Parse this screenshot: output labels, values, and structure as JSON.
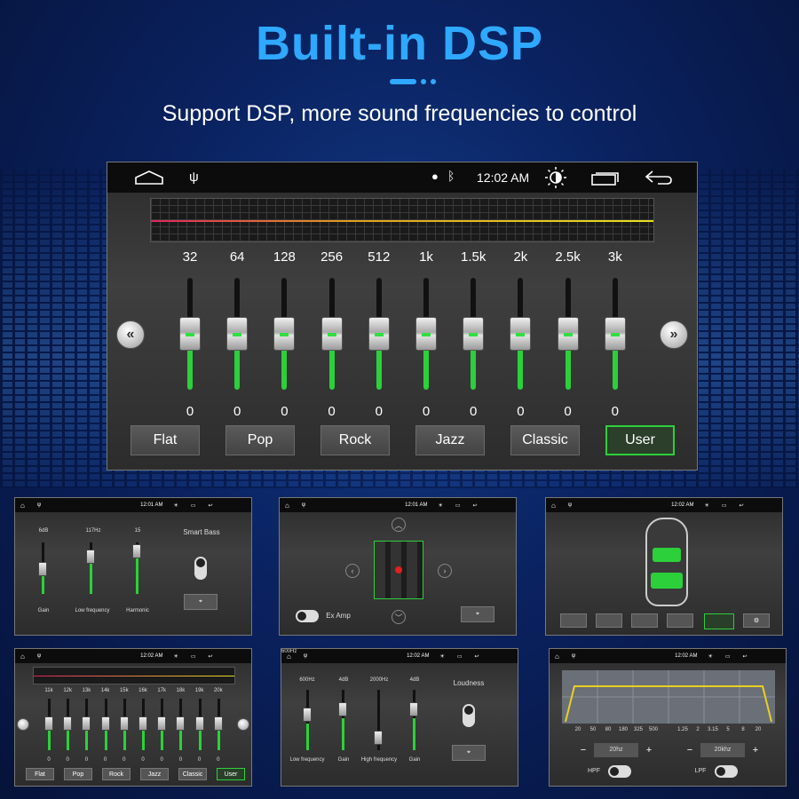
{
  "header": {
    "title": "Built-in DSP",
    "subtitle": "Support DSP, more sound frequencies to control"
  },
  "main_screen": {
    "status": {
      "time": "12:02 AM"
    },
    "eq_bands": [
      {
        "freq": "32",
        "value": "0"
      },
      {
        "freq": "64",
        "value": "0"
      },
      {
        "freq": "128",
        "value": "0"
      },
      {
        "freq": "256",
        "value": "0"
      },
      {
        "freq": "512",
        "value": "0"
      },
      {
        "freq": "1k",
        "value": "0"
      },
      {
        "freq": "1.5k",
        "value": "0"
      },
      {
        "freq": "2k",
        "value": "0"
      },
      {
        "freq": "2.5k",
        "value": "0"
      },
      {
        "freq": "3k",
        "value": "0"
      }
    ],
    "presets": [
      "Flat",
      "Pop",
      "Rock",
      "Jazz",
      "Classic",
      "User"
    ],
    "selected_preset": "User",
    "prev_icon": "«",
    "next_icon": "»"
  },
  "thumbs": {
    "bass": {
      "time": "12:01 AM",
      "slider1_value": "6dB",
      "slider1_label": "Gain",
      "slider2_value": "117Hz",
      "slider2_label": "Low frequency",
      "slider3_value": "15",
      "slider3_label": "Harmonic",
      "title": "Smart Bass"
    },
    "seats": {
      "time": "12:01 AM",
      "label": "Ex Amp"
    },
    "car": {
      "time": "12:02 AM"
    },
    "eq_high": {
      "time": "12:02 AM",
      "freqs": [
        "11k",
        "12k",
        "13k",
        "14k",
        "15k",
        "16k",
        "17k",
        "18k",
        "19k",
        "20k"
      ],
      "values": [
        "0",
        "0",
        "0",
        "0",
        "0",
        "0",
        "0",
        "0",
        "0",
        "0"
      ],
      "presets": [
        "Flat",
        "Pop",
        "Rock",
        "Jazz",
        "Classic",
        "User"
      ]
    },
    "loudness": {
      "time": "12:02 AM",
      "s1_value": "600Hz",
      "s1_label": "Low frequency",
      "s2_value": "4dB",
      "s2_label": "Gain",
      "s3_value": "2000Hz",
      "s3_label": "High frequency",
      "s4_value": "4dB",
      "s4_label": "Gain",
      "title": "Loudness"
    },
    "filter": {
      "time": "12:02 AM",
      "left_ticks": [
        "20",
        "50",
        "80",
        "180",
        "325",
        "500"
      ],
      "right_ticks": [
        "1.25",
        "2",
        "3.15",
        "5",
        "8",
        "20"
      ],
      "hpf_value": "20hz",
      "lpf_value": "20khz",
      "hpf_label": "HPF",
      "lpf_label": "LPF"
    }
  }
}
